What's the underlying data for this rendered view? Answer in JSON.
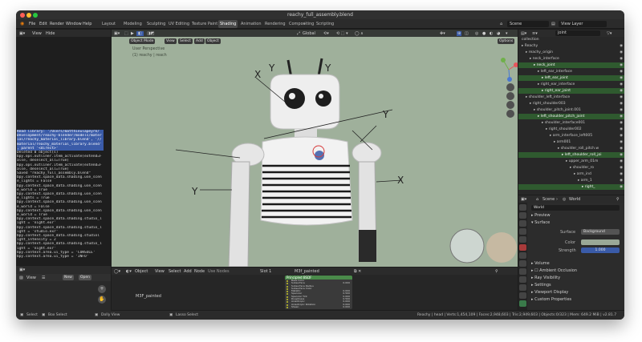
{
  "window": {
    "title": "reachy_full_assembly.blend"
  },
  "menu": [
    "File",
    "Edit",
    "Render",
    "Window",
    "Help"
  ],
  "workspaces": [
    "Layout",
    "Modeling",
    "Sculpting",
    "UV Editing",
    "Texture Paint",
    "Shading",
    "Animation",
    "Rendering",
    "Compositing",
    "Scripting"
  ],
  "active_workspace": "Shading",
  "scene": {
    "label": "Scene",
    "view_layer": "View Layer"
  },
  "console": {
    "header_items": [
      "View",
      "Hide"
    ],
    "lines": [
      "Read library: '/Users/matthieulapeyre/",
      "Development/reachy-blender/models/mater",
      "ial/reachy_material_library.blend', '//",
      "material/reachy_material_library.blend'",
      ", parent '<direct>'",
      "Deleted 0 object(s)",
      "bpy.ops.outliner.item_activate(extend=F",
      "alse, deselect_all=True)",
      "bpy.ops.outliner.item_activate(extend=F",
      "alse, deselect_all=True)",
      "Saved \"reachy_full_assembly.blend\"",
      "bpy.context.space_data.shading.use_scen",
      "e_lights = False",
      "bpy.context.space_data.shading.use_scen",
      "e_world = True",
      "bpy.context.space_data.shading.use_scen",
      "e_lights = True",
      "bpy.context.space_data.shading.use_scen",
      "e_world = False",
      "bpy.context.space_data.shading.use_scen",
      "e_world = True",
      "bpy.context.space_data.shading.studio_l",
      "ight = 'night.exr'",
      "bpy.context.space_data.shading.studio_l",
      "ight = 'studio.exr'",
      "bpy.context.space_data.shading.studiol",
      "ight_intensity = 2",
      "bpy.context.space_data.shading.studio_l",
      "ight = 'night.exr'",
      "bpy.context.area.ui_type = 'CONSOLE'",
      "bpy.context.area.ui_type = 'INFO'"
    ],
    "selected_count": 5
  },
  "filebrowser": {
    "view_label": "View",
    "new_label": "New",
    "open_label": "Open"
  },
  "viewport": {
    "mode": "Object Mode",
    "menu": [
      "View",
      "Select",
      "Add",
      "Object"
    ],
    "overlay_line1": "User Perspective",
    "overlay_line2": "(1) reachy | reach",
    "orientation": "Global",
    "options_label": "Options"
  },
  "node_editor": {
    "mode": "Object",
    "menu": [
      "View",
      "Select",
      "Add",
      "Node"
    ],
    "use_nodes": "Use Nodes",
    "slot": "Slot 1",
    "material": "M3f_painted",
    "node_label": "M3F_painted",
    "bsdf_title": "Principled BSDF",
    "bsdf_rows": [
      {
        "label": "Base Color",
        "value": ""
      },
      {
        "label": "Subsurface",
        "value": "0.000"
      },
      {
        "label": "Subsurface Radius",
        "value": ""
      },
      {
        "label": "Subsurface Color",
        "value": ""
      },
      {
        "label": "Metallic",
        "value": "0.000"
      },
      {
        "label": "Specular",
        "value": "0.500"
      },
      {
        "label": "Specular Tint",
        "value": "0.000"
      },
      {
        "label": "Roughness",
        "value": "0.500"
      },
      {
        "label": "Anisotropic",
        "value": "0.000"
      },
      {
        "label": "Anisotropic Rotation",
        "value": "0.000"
      },
      {
        "label": "Sheen",
        "value": "0.000"
      }
    ]
  },
  "outliner": {
    "search": "joint",
    "title": "collection",
    "rows": [
      {
        "label": "Reachy",
        "depth": 0,
        "hl": false
      },
      {
        "label": "reachy_origin",
        "depth": 1,
        "hl": false
      },
      {
        "label": "neck_interface",
        "depth": 2,
        "hl": false
      },
      {
        "label": "neck_joint",
        "depth": 3,
        "hl": true
      },
      {
        "label": "left_ear_interface",
        "depth": 4,
        "hl": false
      },
      {
        "label": "left_ear_joint",
        "depth": 5,
        "hl": true
      },
      {
        "label": "right_ear_interface",
        "depth": 4,
        "hl": false
      },
      {
        "label": "right_ear_joint",
        "depth": 5,
        "hl": true
      },
      {
        "label": "shoulder_left_interface",
        "depth": 1,
        "hl": false
      },
      {
        "label": "right_shoulder003",
        "depth": 2,
        "hl": false
      },
      {
        "label": "shoulder_pitch_joint.001",
        "depth": 3,
        "hl": false
      },
      {
        "label": "left_shoulder_pitch_joint",
        "depth": 4,
        "hl": true
      },
      {
        "label": "shoulder_interface001",
        "depth": 5,
        "hl": false
      },
      {
        "label": "right_shoulder002",
        "depth": 6,
        "hl": false
      },
      {
        "label": "arm_interface_left005",
        "depth": 7,
        "hl": false
      },
      {
        "label": "arm001",
        "depth": 8,
        "hl": false
      },
      {
        "label": "shoulder_roll_pitch.w",
        "depth": 9,
        "hl": false
      },
      {
        "label": "left_shoulder_roll_joi",
        "depth": 10,
        "hl": true
      },
      {
        "label": "upper_arm_01m",
        "depth": 11,
        "hl": false
      },
      {
        "label": "shoulder_ro",
        "depth": 12,
        "hl": false
      },
      {
        "label": "arm_ind",
        "depth": 13,
        "hl": false
      },
      {
        "label": "arm_1",
        "depth": 14,
        "hl": false
      },
      {
        "label": "right_",
        "depth": 15,
        "hl": true
      }
    ]
  },
  "properties": {
    "tab_scene": "Scene",
    "tab_world": "World",
    "world_name": "World",
    "sections": {
      "preview": "Preview",
      "surface": "Surface",
      "volume": "Volume",
      "ambient_occlusion": "Ambient Occlusion",
      "ray_visibility": "Ray Visibility",
      "settings": "Settings",
      "viewport_display": "Viewport Display",
      "custom_properties": "Custom Properties"
    },
    "surface_label": "Surface",
    "surface_value": "Background",
    "color_label": "Color",
    "strength_label": "Strength",
    "strength_value": "1.000"
  },
  "statusbar": {
    "select": "Select",
    "box_select": "Box Select",
    "dolly_view": "Dolly View",
    "lasso_select": "Lasso Select",
    "stats": "Reachy | head | Verts:1,454,109 | Faces:2,948,603 | Tris:2,949,603 | Objects:0/323 | Mem: 649.2 MiB | v2.81.7"
  },
  "colors": {
    "viewport_bg": "#9fb09b",
    "accent_blue": "#3a5ba8",
    "outliner_highlight": "#2f5a2f",
    "active_tab": "#4a4a4a"
  }
}
